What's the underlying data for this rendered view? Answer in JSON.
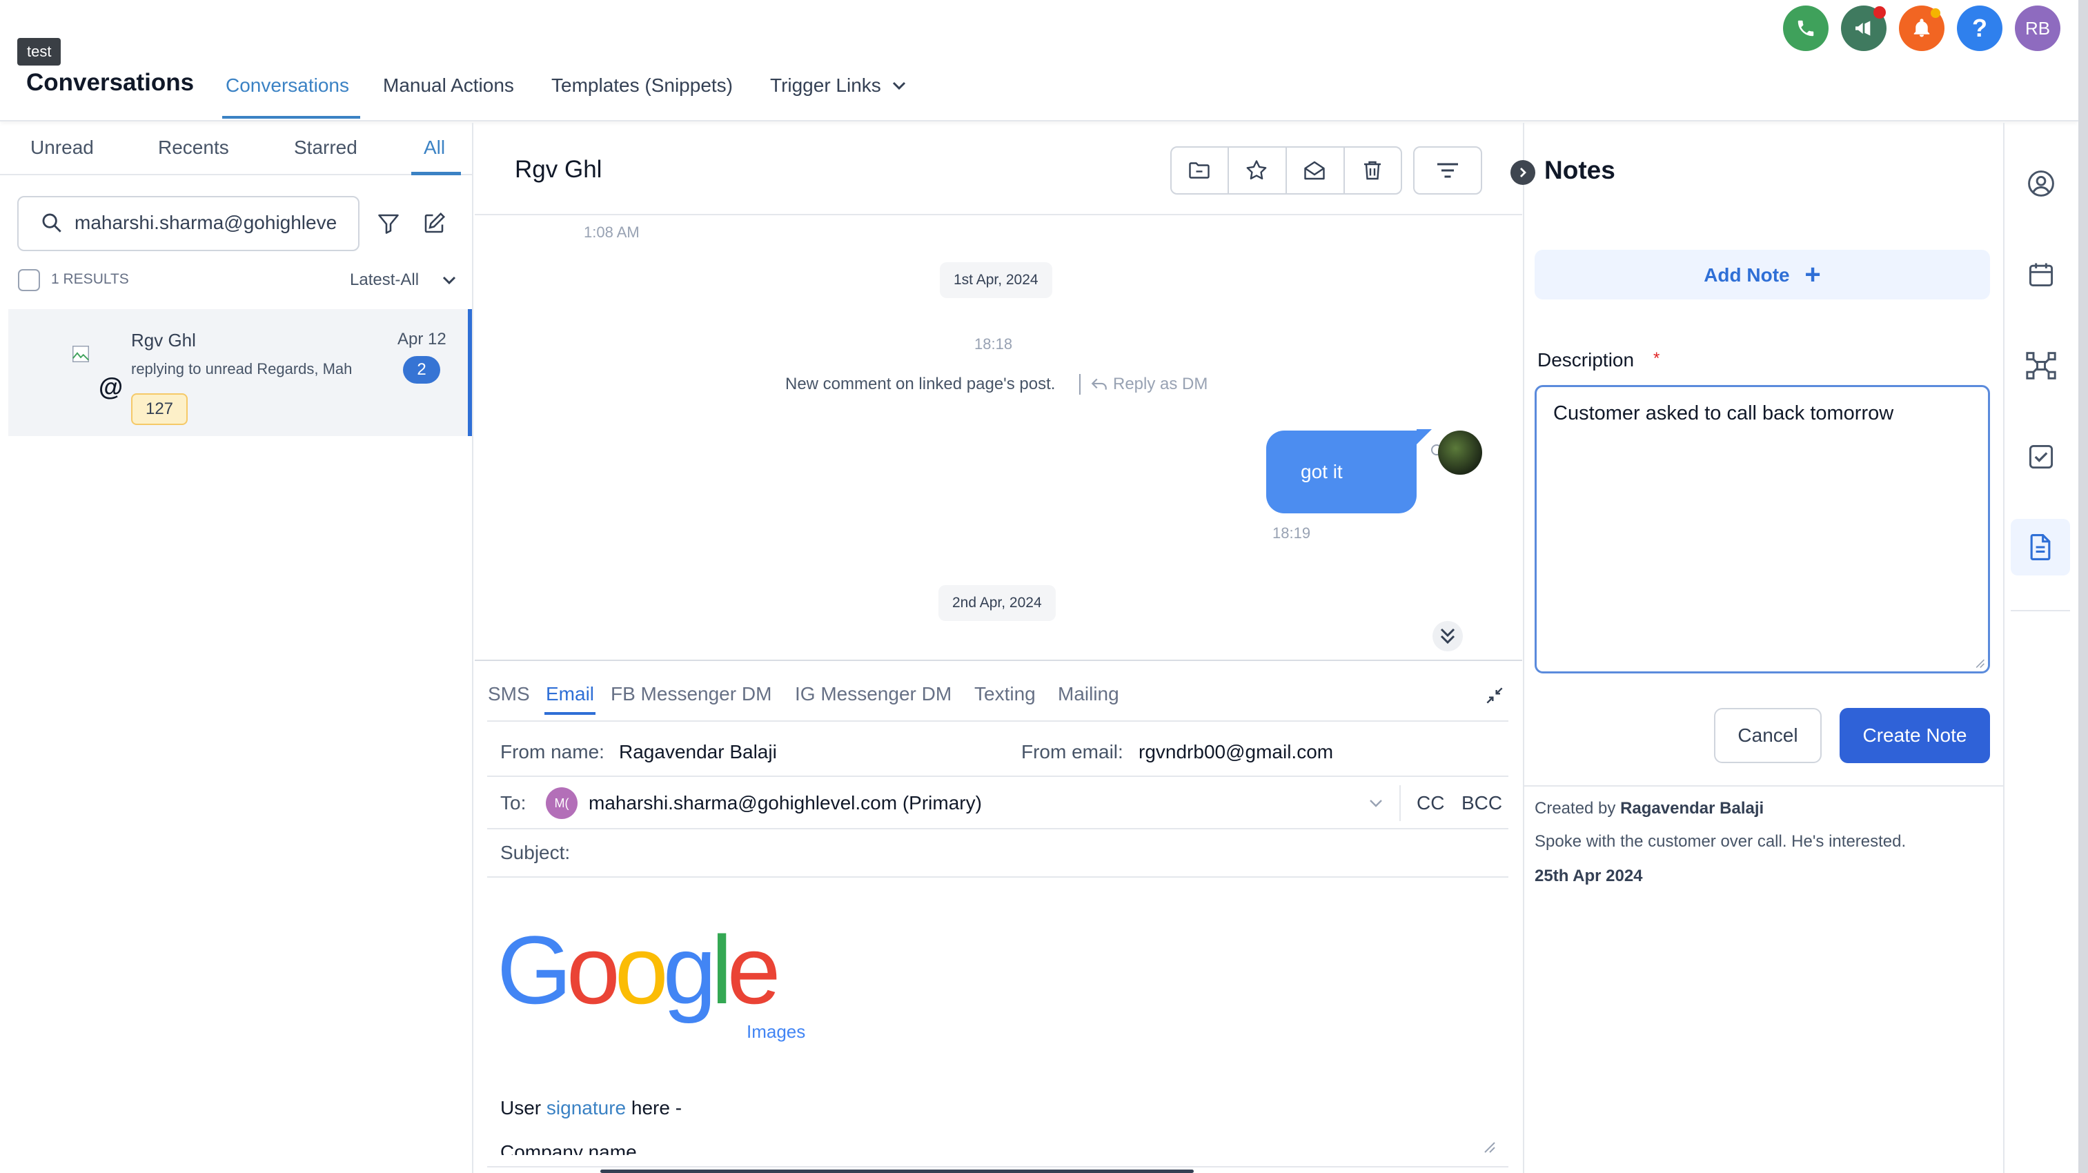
{
  "header": {
    "tag": "test",
    "app_title": "Conversations",
    "nav": [
      "Conversations",
      "Manual Actions",
      "Templates (Snippets)",
      "Trigger Links"
    ],
    "avatar_initials": "RB",
    "colors": {
      "phone": "#3fa15b",
      "announce": "#3f7a5f",
      "bell": "#f26522",
      "help": "#2f80ed",
      "avatar": "#8e6bbf",
      "accent": "#3b82c4"
    }
  },
  "sidebar": {
    "tabs": [
      "Unread",
      "Recents",
      "Starred",
      "All"
    ],
    "active_tab": "All",
    "search_value": "maharshi.sharma@gohighleve",
    "results": "1 RESULTS",
    "sort": "Latest-All",
    "conversation": {
      "name": "Rgv Ghl",
      "date": "Apr 12",
      "preview": "replying to unread Regards, Mah",
      "unread_count": "2",
      "tag": "127"
    }
  },
  "chat": {
    "contact_name": "Rgv Ghl",
    "time_top": "1:08 AM",
    "date1": "1st Apr, 2024",
    "time1": "18:18",
    "comment_text": "New comment on linked page's post.",
    "reply_dm": "Reply as DM",
    "bubble_text": "got it",
    "bubble_time": "18:19",
    "date2": "2nd Apr, 2024"
  },
  "composer": {
    "channels": [
      "SMS",
      "Email",
      "FB Messenger DM",
      "IG Messenger DM",
      "Texting",
      "Mailing"
    ],
    "active_channel": "Email",
    "from_name_label": "From name:",
    "from_name": "Ragavendar Balaji",
    "from_email_label": "From email:",
    "from_email": "rgvndrb00@gmail.com",
    "to_label": "To:",
    "to_avatar": "M(",
    "to_value": "maharshi.sharma@gohighlevel.com (Primary)",
    "cc": "CC",
    "bcc": "BCC",
    "subject_label": "Subject:",
    "logo_text": "Google",
    "logo_sub": "Images",
    "sig_prefix": "User ",
    "sig_link": "signature",
    "sig_suffix": " here -",
    "company": "Company name"
  },
  "notes": {
    "title": "Notes",
    "add_note": "Add Note",
    "description_label": "Description",
    "required_mark": "*",
    "description_value": "Customer asked to call back tomorrow",
    "cancel": "Cancel",
    "create": "Create Note",
    "created_by_label": "Created by",
    "created_by": "Ragavendar Balaji",
    "note_text": "Spoke with the customer over call. He's interested.",
    "note_date": "25th Apr 2024"
  },
  "rail_icons": [
    "user-circle-icon",
    "calendar-icon",
    "network-icon",
    "checkbox-icon",
    "document-icon"
  ]
}
